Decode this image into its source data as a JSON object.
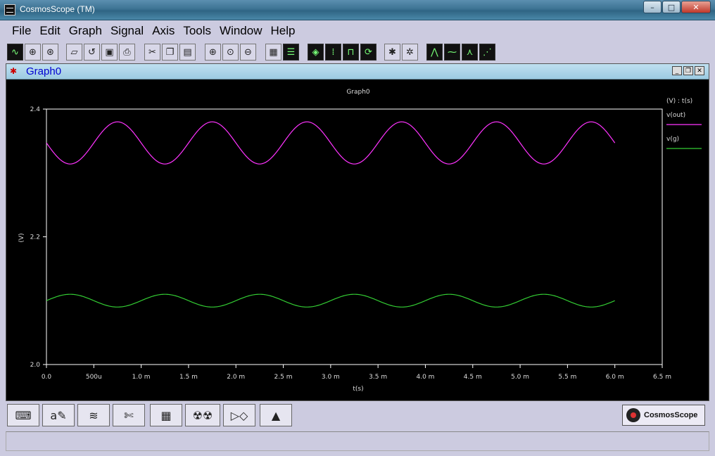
{
  "window": {
    "title": "CosmosScope (TM)",
    "buttons": {
      "minimize": "–",
      "maximize": "□",
      "close": "✕"
    }
  },
  "menu": [
    "File",
    "Edit",
    "Graph",
    "Signal",
    "Axis",
    "Tools",
    "Window",
    "Help"
  ],
  "toolbar_icons": [
    "new-graph-icon",
    "open-circle-icon",
    "wheel-icon",
    "open-folder-icon",
    "undo-icon",
    "save-icon",
    "print-icon",
    "cut-icon",
    "copy-icon",
    "paste-icon",
    "zoom-in-icon",
    "zoom-fit-icon",
    "zoom-out-icon",
    "stack-icon",
    "panel-icon",
    "eraser-icon",
    "grid-icon",
    "pulse-icon",
    "refresh-icon",
    "bug-icon",
    "bug2-icon",
    "measure1-icon",
    "measure2-icon",
    "measure3-icon",
    "measure4-icon"
  ],
  "graph_window": {
    "title": "Graph0"
  },
  "bottom_icons": [
    "keyboard-icon",
    "annotate-icon",
    "waveform-icon",
    "scissors-icon",
    "calculator-icon",
    "radiation-icon",
    "schematic-icon",
    "matlab-icon"
  ],
  "logo_text": "CosmosScope",
  "colors": {
    "vout": "#ff33ff",
    "vg": "#33cc33",
    "plot_bg": "#000000",
    "axis": "#ffffff"
  },
  "chart_data": {
    "type": "line",
    "title": "Graph0",
    "xlabel": "t(s)",
    "ylabel": "(V)",
    "legend_header": "(V) : t(s)",
    "legend_position": "right",
    "xlim": [
      0.0,
      0.0065
    ],
    "ylim": [
      2.0,
      2.4
    ],
    "x_ticks": [
      0.0,
      0.0005,
      0.001,
      0.0015,
      0.002,
      0.0025,
      0.003,
      0.0035,
      0.004,
      0.0045,
      0.005,
      0.0055,
      0.006,
      0.0065
    ],
    "x_tick_labels": [
      "0.0",
      "500u",
      "1.0 m",
      "1.5 m",
      "2.0 m",
      "2.5 m",
      "3.0 m",
      "3.5 m",
      "4.0 m",
      "4.5 m",
      "5.0 m",
      "5.5 m",
      "6.0 m",
      "6.5 m"
    ],
    "y_ticks": [
      2.0,
      2.2,
      2.4
    ],
    "y_tick_labels": [
      "2.0",
      "2.2",
      "2.4"
    ],
    "series": [
      {
        "name": "v(out)",
        "color": "#ff33ff",
        "offset": 2.347,
        "amplitude": 0.033,
        "period": 0.001,
        "phase": "negative-sine",
        "x": [
          0,
          0.00025,
          0.0005,
          0.00075,
          0.001,
          0.00125,
          0.0015,
          0.00175,
          0.002,
          0.00225,
          0.0025,
          0.00275,
          0.003,
          0.00325,
          0.0035,
          0.00375,
          0.004,
          0.00425,
          0.0045,
          0.00475,
          0.005,
          0.00525,
          0.0055,
          0.00575,
          0.006
        ],
        "y": [
          2.347,
          2.314,
          2.347,
          2.38,
          2.347,
          2.314,
          2.347,
          2.38,
          2.347,
          2.314,
          2.347,
          2.38,
          2.347,
          2.314,
          2.347,
          2.38,
          2.347,
          2.314,
          2.347,
          2.38,
          2.347,
          2.314,
          2.347,
          2.38,
          2.347
        ]
      },
      {
        "name": "v(g)",
        "color": "#33cc33",
        "offset": 2.1,
        "amplitude": 0.01,
        "period": 0.001,
        "phase": "positive-sine",
        "x": [
          0,
          0.00025,
          0.0005,
          0.00075,
          0.001,
          0.00125,
          0.0015,
          0.00175,
          0.002,
          0.00225,
          0.0025,
          0.00275,
          0.003,
          0.00325,
          0.0035,
          0.00375,
          0.004,
          0.00425,
          0.0045,
          0.00475,
          0.005,
          0.00525,
          0.0055,
          0.00575,
          0.006
        ],
        "y": [
          2.1,
          2.11,
          2.1,
          2.09,
          2.1,
          2.11,
          2.1,
          2.09,
          2.1,
          2.11,
          2.1,
          2.09,
          2.1,
          2.11,
          2.1,
          2.09,
          2.1,
          2.11,
          2.1,
          2.09,
          2.1,
          2.11,
          2.1,
          2.09,
          2.1
        ]
      }
    ]
  }
}
